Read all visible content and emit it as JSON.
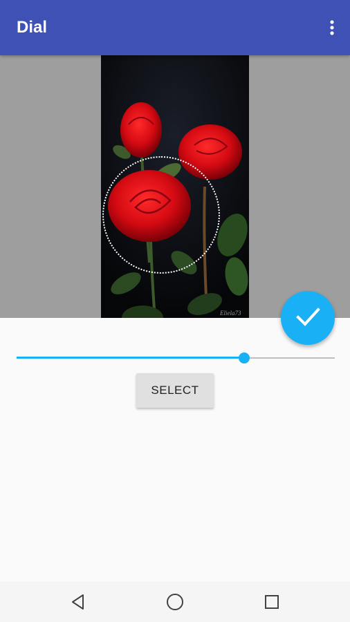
{
  "app_bar": {
    "title": "Dial",
    "overflow_icon": "more-vert-icon",
    "color": "#3f51b5"
  },
  "image": {
    "subject": "red roses",
    "watermark": "Eliela73"
  },
  "fab": {
    "icon": "check-icon",
    "color": "#1ab0f5"
  },
  "slider": {
    "value": 0.715,
    "accent": "#1ab0f5"
  },
  "select_button": {
    "label": "SELECT"
  },
  "nav_bar": {
    "back_icon": "back-icon",
    "home_icon": "home-icon",
    "recents_icon": "recents-icon"
  }
}
